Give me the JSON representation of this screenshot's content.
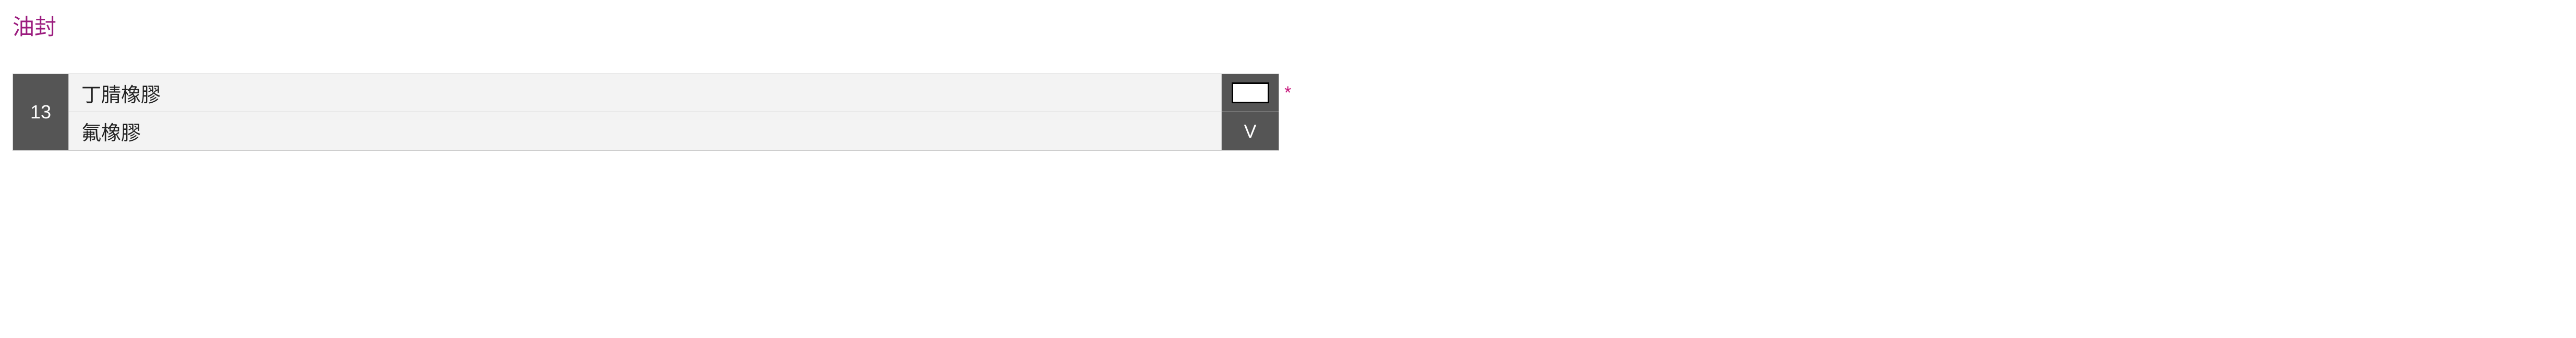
{
  "section": {
    "title": "油封"
  },
  "table": {
    "number": "13",
    "rows": [
      {
        "label": "丁腈橡膠",
        "code": ""
      },
      {
        "label": "氟橡膠",
        "code": "V"
      }
    ],
    "required_mark": "*"
  }
}
